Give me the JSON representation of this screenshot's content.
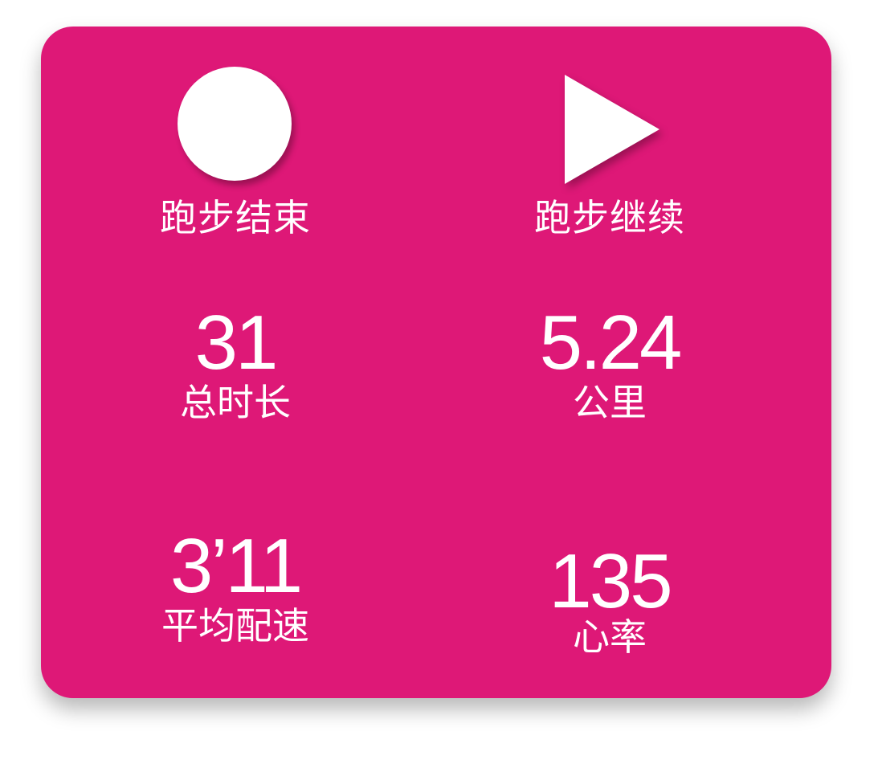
{
  "controls": {
    "stop": {
      "label": "跑步结束",
      "icon": "stop-circle-icon"
    },
    "resume": {
      "label": "跑步继续",
      "icon": "play-icon"
    }
  },
  "stats": {
    "duration": {
      "value": "31",
      "label": "总时长"
    },
    "distance": {
      "value": "5.24",
      "label": "公里"
    },
    "pace": {
      "value": "3’11",
      "label": "平均配速"
    },
    "heart_rate": {
      "value": "135",
      "label": "心率"
    }
  },
  "colors": {
    "card_background": "#DE1877",
    "foreground": "#FFFFFF"
  }
}
